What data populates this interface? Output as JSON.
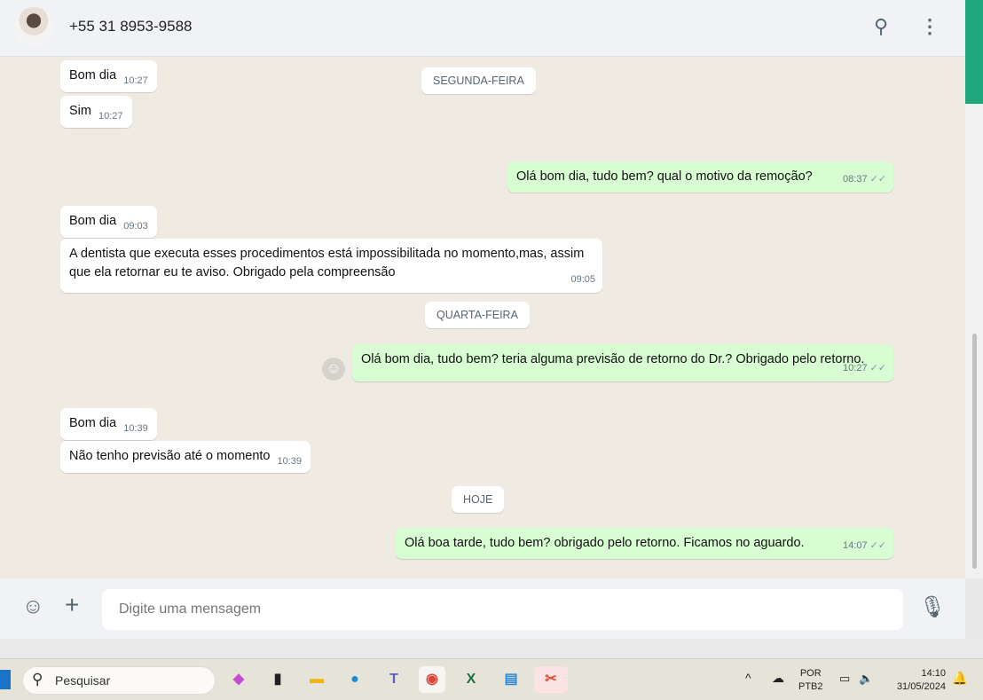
{
  "header": {
    "contact": "+55 31 8953-9588",
    "icons": [
      "search-icon",
      "kebab-menu-icon"
    ]
  },
  "dates": [
    "SEGUNDA-FEIRA",
    "QUARTA-FEIRA",
    "HOJE"
  ],
  "messages": [
    {
      "dir": "in",
      "text": "Bom dia",
      "time": "10:27"
    },
    {
      "dir": "in",
      "text": "Sim",
      "time": "10:27"
    },
    {
      "dir": "out",
      "text": "Olá bom dia, tudo bem? qual o motivo da remoção?",
      "time": "08:37"
    },
    {
      "dir": "in",
      "text": "Bom dia",
      "time": "09:03"
    },
    {
      "dir": "in",
      "text": "A dentista que executa esses procedimentos está impossibilitada no momento,mas, assim que ela retornar eu te aviso. Obrigado pela compreensão",
      "time": "09:05"
    },
    {
      "dir": "out",
      "text": "Olá bom dia, tudo bem? teria alguma previsão de retorno do Dr.? Obrigado pelo retorno.",
      "time": "10:27"
    },
    {
      "dir": "in",
      "text": "Bom dia",
      "time": "10:39"
    },
    {
      "dir": "in",
      "text": "Não tenho previsão até o momento",
      "time": "10:39"
    },
    {
      "dir": "out",
      "text": "Olá boa tarde, tudo bem? obrigado pelo retorno. Ficamos no aguardo.",
      "time": "14:07"
    }
  ],
  "composer": {
    "placeholder": "Digite uma mensagem"
  },
  "taskbar": {
    "search": "Pesquisar",
    "lang1": "POR",
    "lang2": "PTB2",
    "time": "14:10",
    "date": "31/05/2024"
  },
  "colors": {
    "outgoing": "#d9fdd3",
    "incoming": "#ffffff",
    "chat_bg": "#efeae2",
    "accent": "#1fa67a"
  }
}
